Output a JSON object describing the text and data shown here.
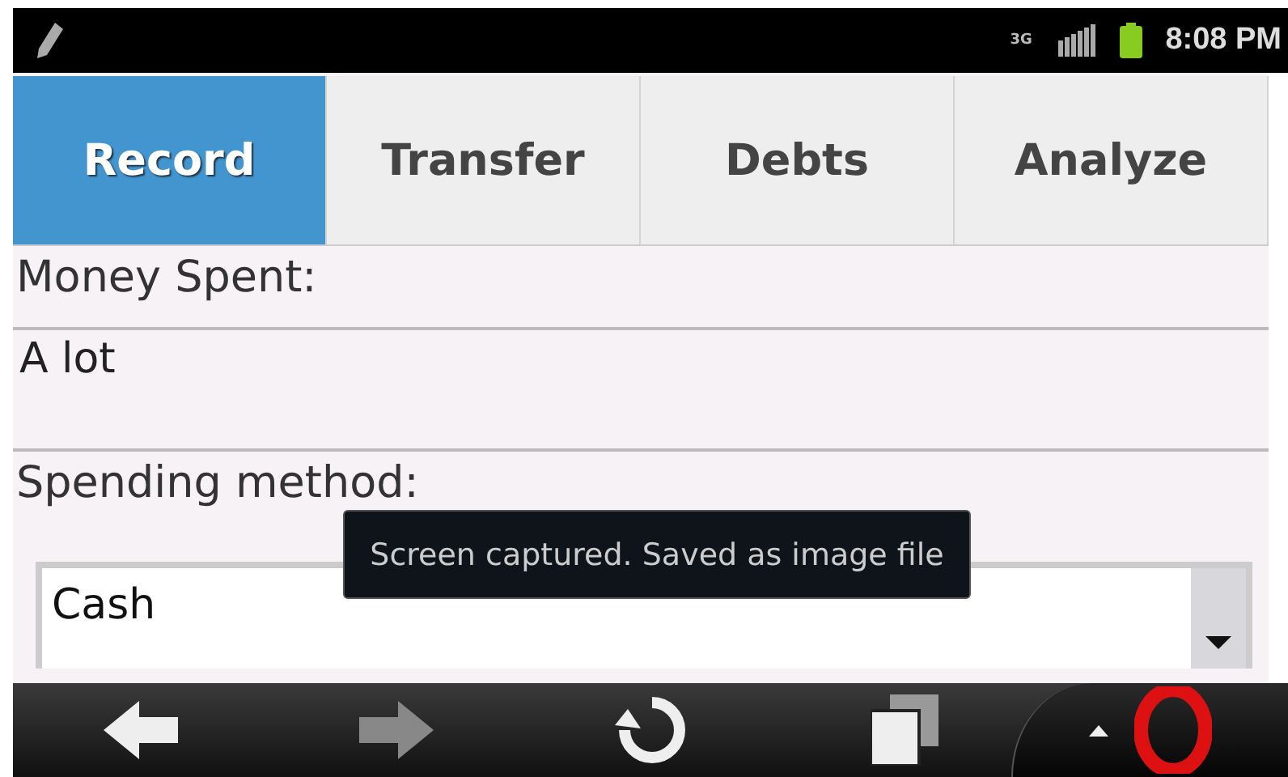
{
  "status_bar": {
    "time": "8:08 PM",
    "network": "3G"
  },
  "tabs": [
    {
      "label": "Record",
      "selected": true
    },
    {
      "label": "Transfer",
      "selected": false
    },
    {
      "label": "Debts",
      "selected": false
    },
    {
      "label": "Analyze",
      "selected": false
    }
  ],
  "money_spent": {
    "label": "Money Spent:",
    "value": "A lot"
  },
  "spending_method": {
    "label": "Spending method:",
    "value": "Cash"
  },
  "toast": "Screen captured. Saved as image file",
  "nav_bar": {
    "back_disabled": false,
    "forward_disabled": true
  }
}
